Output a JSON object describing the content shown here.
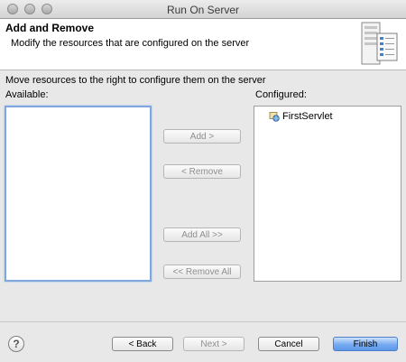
{
  "window": {
    "title": "Run On Server"
  },
  "header": {
    "title": "Add and Remove",
    "description": "Modify the resources that are configured on the server",
    "icon": "server-config-icon"
  },
  "main": {
    "instruction": "Move resources to the right to configure them on the server",
    "available_label": "Available:",
    "configured_label": "Configured:",
    "available_items": [],
    "configured_items": [
      {
        "label": "FirstServlet",
        "icon": "web-project-icon"
      }
    ]
  },
  "buttons": {
    "add": "Add >",
    "remove": "< Remove",
    "add_all": "Add All >>",
    "remove_all": "<< Remove All"
  },
  "footer": {
    "help_icon": "help-icon",
    "back": "< Back",
    "next": "Next >",
    "cancel": "Cancel",
    "finish": "Finish"
  }
}
